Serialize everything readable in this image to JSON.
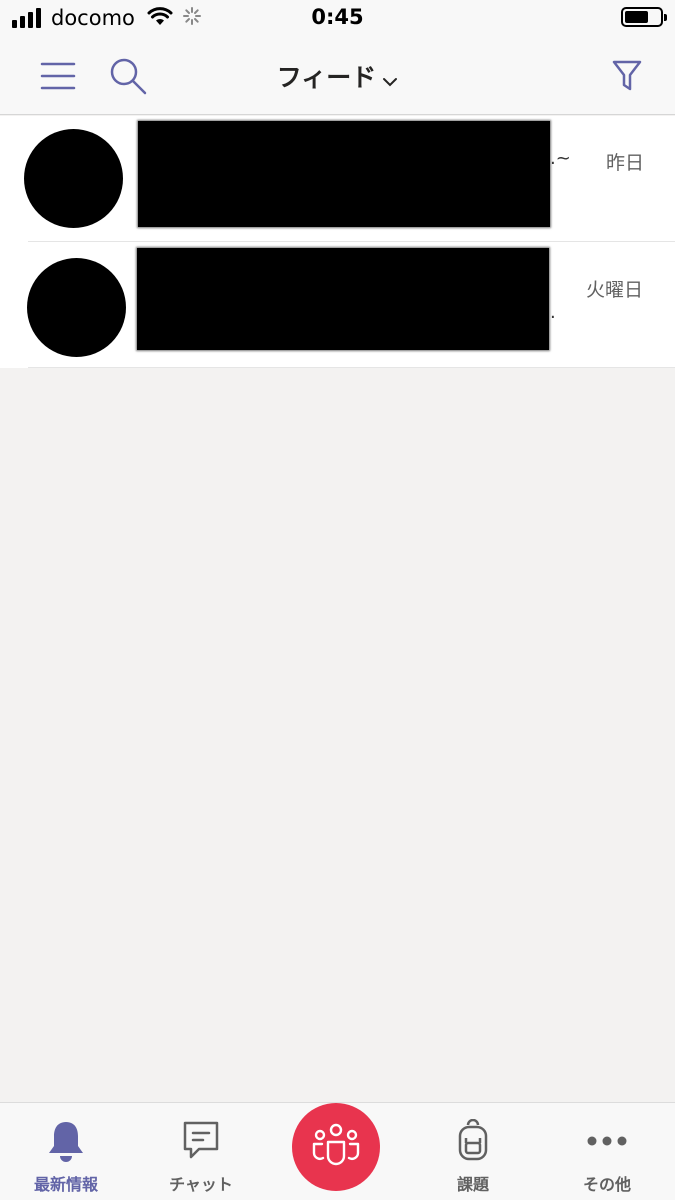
{
  "status_bar": {
    "carrier": "docomo",
    "time": "0:45"
  },
  "header": {
    "title": "フィード",
    "icons": [
      "hamburger-icon",
      "search-icon",
      "chevron-down-icon",
      "filter-icon"
    ]
  },
  "feed": {
    "items": [
      {
        "time": "昨日",
        "trail": ".~",
        "redacted": true
      },
      {
        "time": "火曜日",
        "trail": ".",
        "redacted": true
      }
    ]
  },
  "tab_bar": {
    "items": [
      {
        "label": "最新情報",
        "icon": "bell-icon",
        "active": true
      },
      {
        "label": "チャット",
        "icon": "chat-icon",
        "active": false
      },
      {
        "label": "",
        "icon": "teams-icon",
        "active": false
      },
      {
        "label": "課題",
        "icon": "backpack-icon",
        "active": false
      },
      {
        "label": "その他",
        "icon": "more-icon",
        "active": false
      }
    ]
  },
  "colors": {
    "accent": "#6264a7",
    "fab": "#e8344e",
    "background": "#f3f2f1"
  }
}
